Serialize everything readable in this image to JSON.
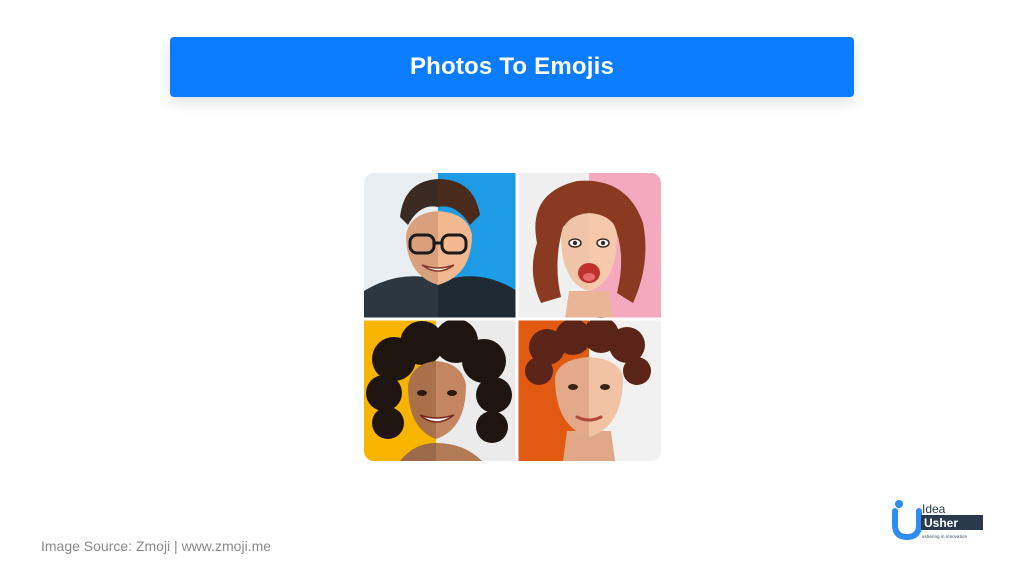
{
  "slide": {
    "title": "Photos To Emojis",
    "image_source": "Image Source: Zmoji | www.zmoji.me"
  },
  "logo": {
    "line1": "Idea",
    "line2": "Usher",
    "tagline": "ushering in innovation"
  },
  "colors": {
    "banner": "#0a7cff",
    "logo_blue": "#2f8cf0",
    "logo_dark": "#2a3a4c"
  }
}
